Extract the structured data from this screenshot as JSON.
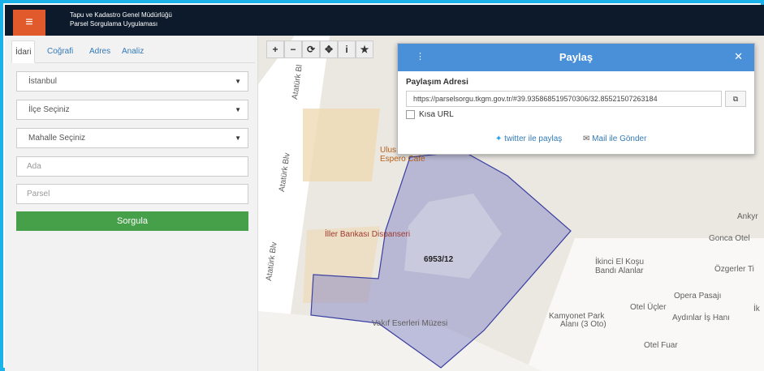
{
  "header": {
    "menu_icon": "hamburger-icon",
    "title_line1": "Tapu ve Kadastro Genel Müdürlüğü",
    "title_line2": "Parsel Sorgulama Uygulaması"
  },
  "sidebar": {
    "tabs": [
      {
        "label": "İdari",
        "active": true
      },
      {
        "label": "Coğrafi"
      },
      {
        "label": "Adres"
      },
      {
        "label": "Analiz"
      }
    ],
    "province_select": "İstanbul",
    "district_select": "İlçe Seçiniz",
    "neighborhood_select": "Mahalle Seçiniz",
    "ada_placeholder": "Ada",
    "parsel_placeholder": "Parsel",
    "submit_label": "Sorgula"
  },
  "map": {
    "toolbar": [
      "+",
      "−",
      "⟳",
      "✥",
      "i",
      "★"
    ],
    "labels": {
      "street1": "Atatürk Bl",
      "street2": "Atatürk Blv",
      "street3": "Atatürk Blv",
      "poi_ulus": "Ulus Müdürlü",
      "poi_espero": "Espero Cafe",
      "poi_iller": "İller Bankası Dispanseri",
      "parcel": "6953/12",
      "poi_ikinci1": "İkinci El Koşu",
      "poi_ikinci2": "Bandı Alanlar",
      "poi_vakif": "Vakıf Eserleri Müzesi",
      "poi_kamyonet1": "Kamyonet Park",
      "poi_kamyonet2": "Alanı (3 Oto)",
      "poi_opera": "Opera Pasajı",
      "poi_otelucler": "Otel Üçler",
      "poi_aydinlar": "Aydınlar İş Hanı",
      "poi_otelfuar": "Otel Fuar",
      "poi_gonca": "Gonca Otel",
      "poi_ozgerler": "Özgerler Ti",
      "poi_ankara": "Ankyr",
      "poi_ik": "İk"
    }
  },
  "share_dialog": {
    "title": "Paylaş",
    "close": "✕",
    "address_label": "Paylaşım Adresi",
    "url": "https://parselsorgu.tkgm.gov.tr/#39.935868519570306/32.85521507263184",
    "short_url_label": "Kısa URL",
    "twitter_label": "twitter ile paylaş",
    "mail_label": "Mail ile Gönder"
  },
  "colors": {
    "accent": "#1ab2e8",
    "header_bg": "#0d1a2b",
    "menu_btn": "#e05a2b",
    "submit": "#45a049",
    "dialog_header": "#4a90d9",
    "parcel_fill": "#7b7fc4"
  }
}
